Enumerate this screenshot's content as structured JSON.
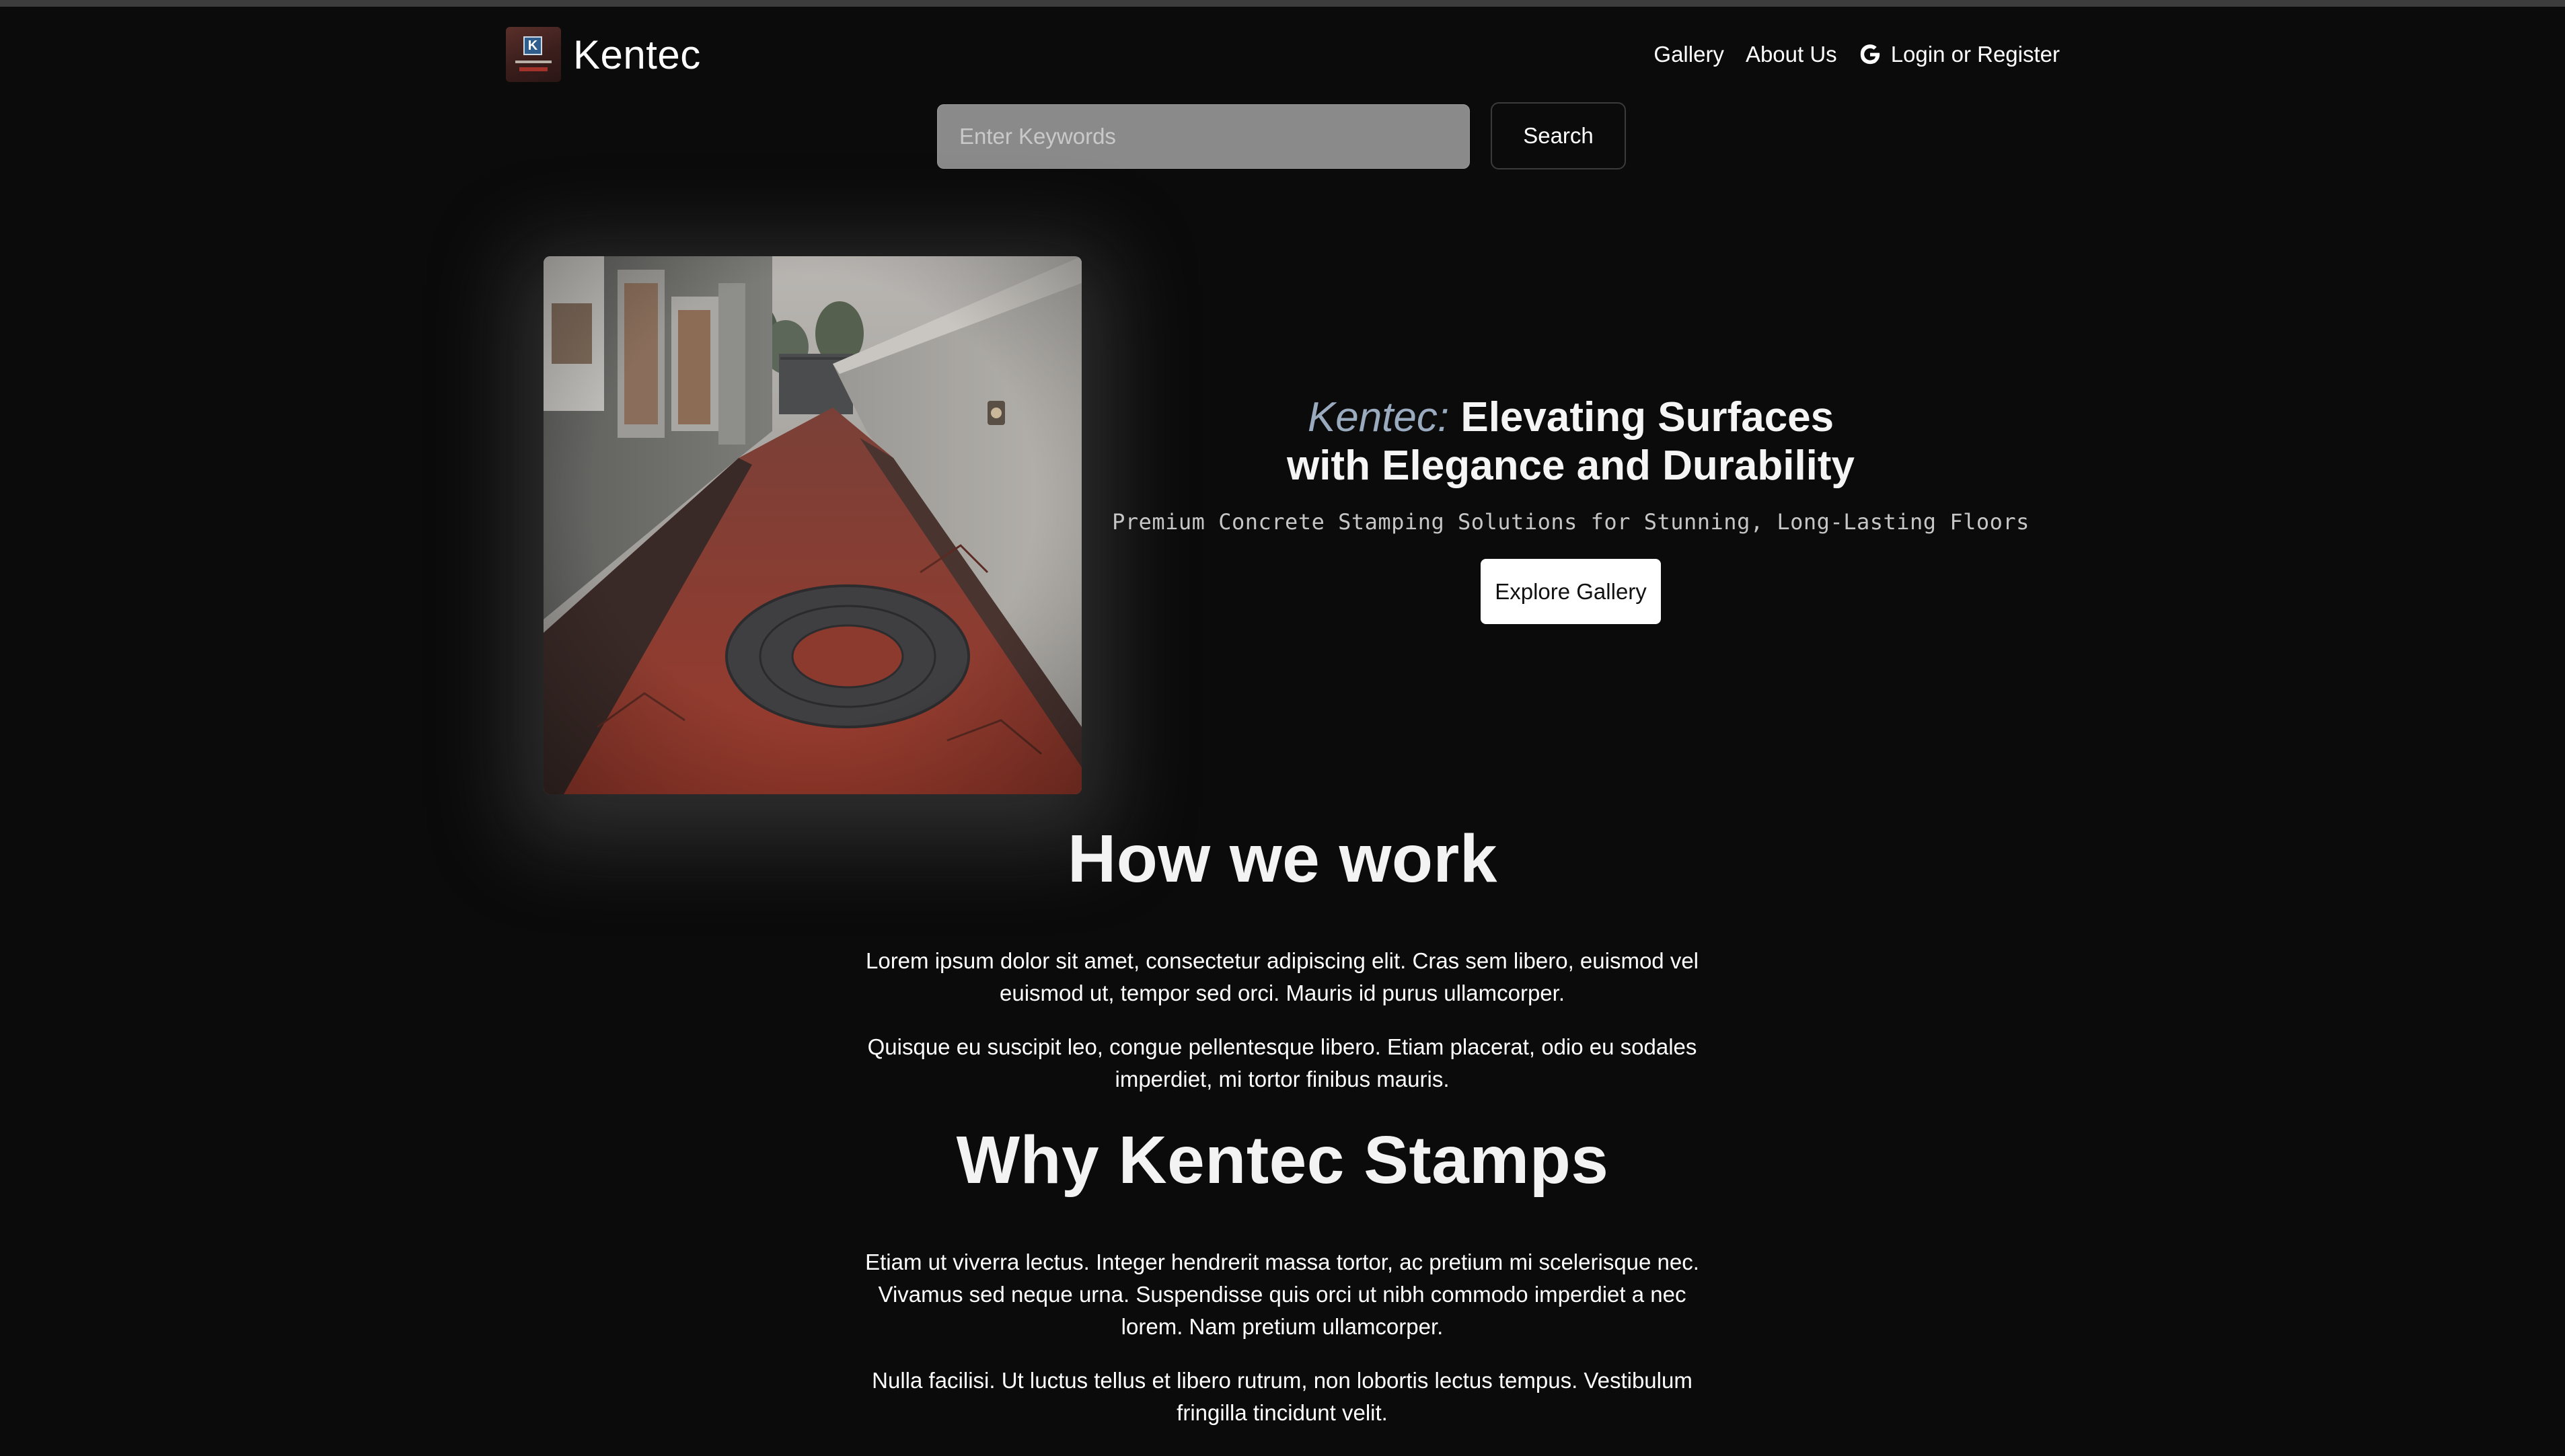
{
  "header": {
    "brand_name": "Kentec",
    "nav": {
      "gallery": "Gallery",
      "about": "About Us",
      "login": "Login or Register"
    }
  },
  "search": {
    "placeholder": "Enter Keywords",
    "button": "Search"
  },
  "hero": {
    "title_accent": "Kentec:",
    "title_line1": "Elevating Surfaces",
    "title_line2": "with Elegance and Durability",
    "subtitle": "Premium Concrete Stamping Solutions for Stunning, Long-Lasting Floors",
    "cta": "Explore Gallery"
  },
  "how_we_work": {
    "title": "How we work",
    "paragraphs": [
      "Lorem ipsum dolor sit amet, consectetur adipiscing elit. Cras sem libero, euismod vel euismod ut, tempor sed orci. Mauris id purus ullamcorper.",
      "Quisque eu suscipit leo, congue pellentesque libero. Etiam placerat, odio eu sodales imperdiet, mi tortor finibus mauris."
    ]
  },
  "why_kentec": {
    "title": "Why Kentec Stamps",
    "paragraphs": [
      "Etiam ut viverra lectus. Integer hendrerit massa tortor, ac pretium mi scelerisque nec. Vivamus sed neque urna. Suspendisse quis orci ut nibh commodo imperdiet a nec lorem. Nam pretium ullamcorper.",
      "Nulla facilisi. Ut luctus tellus et libero rutrum, non lobortis lectus tempus. Vestibulum fringilla tincidunt velit."
    ]
  },
  "icons": {
    "google": "google-icon",
    "logo": "kentec-logo"
  }
}
